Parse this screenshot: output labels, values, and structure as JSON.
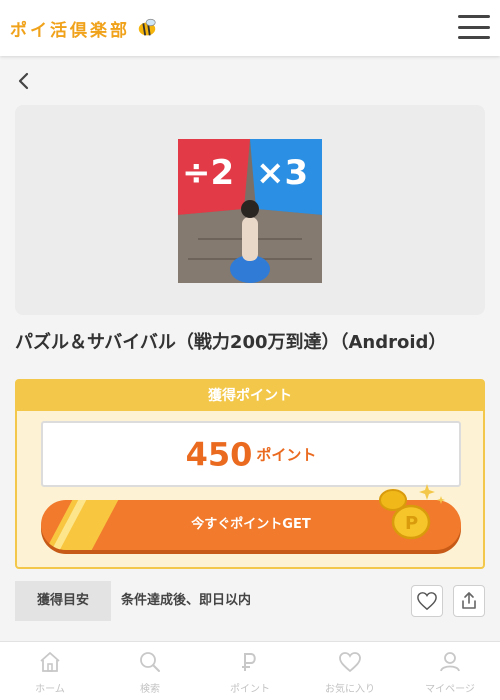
{
  "header": {
    "logo_text": "ポイ活倶楽部",
    "menu_icon": "hamburger-menu-icon"
  },
  "nav_back_icon": "chevron-left-icon",
  "offer": {
    "image_text_left": "÷2",
    "image_text_right": "×3",
    "title": "パズル＆サバイバル（戦力200万到達）（Android）"
  },
  "points": {
    "heading": "獲得ポイント",
    "value": "450",
    "unit": "ポイント",
    "button_label": "今すぐポイントGET"
  },
  "estimate": {
    "label": "獲得目安",
    "value": "条件達成後、即日以内"
  },
  "actions": {
    "favorite_icon": "heart-icon",
    "share_icon": "share-icon"
  },
  "bottom_nav": {
    "items": [
      {
        "label": "ホーム",
        "icon": "home-icon"
      },
      {
        "label": "検索",
        "icon": "search-icon"
      },
      {
        "label": "ポイント",
        "icon": "point-icon"
      },
      {
        "label": "お気に入り",
        "icon": "heart-icon"
      },
      {
        "label": "マイページ",
        "icon": "user-icon"
      }
    ]
  },
  "colors": {
    "accent_orange": "#f17a2c",
    "points_text": "#ea6a1f",
    "gold": "#f3c84a",
    "logo": "#f0a21b"
  }
}
